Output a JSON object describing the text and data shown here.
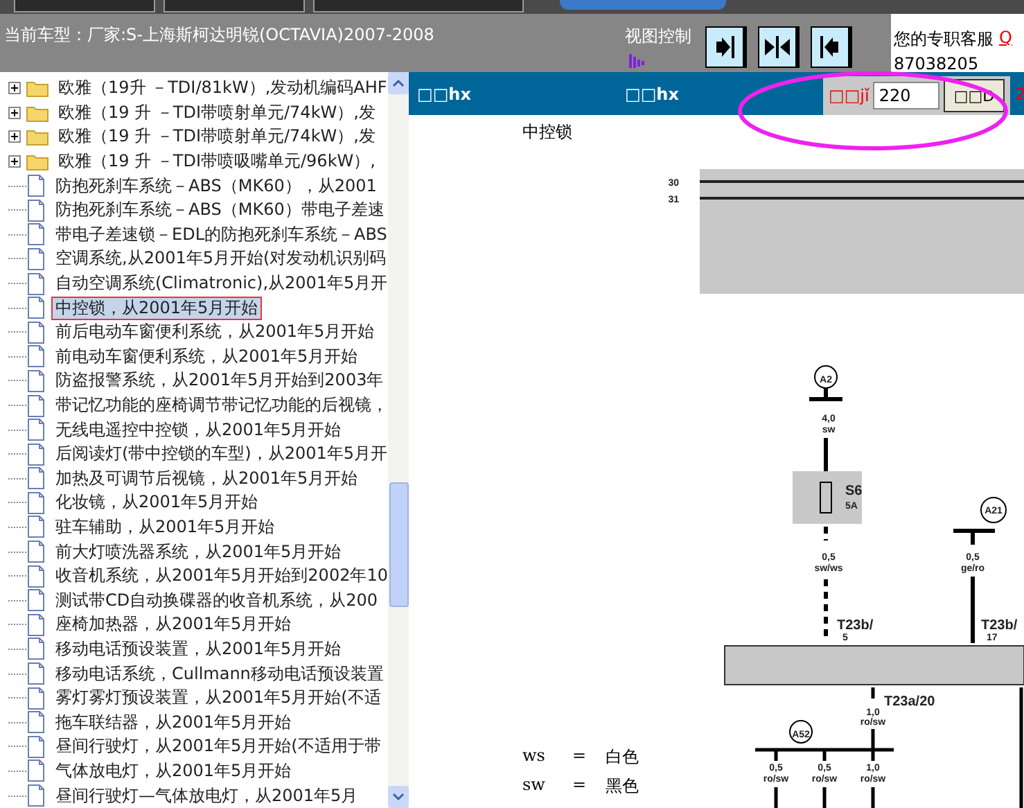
{
  "top_bar": {
    "tabs": [
      {
        "selected": false
      },
      {
        "selected": false
      },
      {
        "selected": false
      },
      {
        "selected": true
      }
    ],
    "model_label": "当前车型：厂家:S-上海斯柯达明锐(OCTAVIA)2007-2008",
    "view_control_label": "视图控制",
    "view_buttons": [
      {
        "kind": "right"
      },
      {
        "kind": "center"
      },
      {
        "kind": "left"
      }
    ],
    "service_label": "您的专职客服",
    "service_link": "Q",
    "service_number": "87038205"
  },
  "tree": {
    "items": [
      {
        "kind": "folder",
        "text": "欧雅（19升 －TDI/81kW）,发动机编码AHF",
        "selected": false
      },
      {
        "kind": "folder",
        "text": "欧雅（19 升 －TDI带喷射单元/74kW）,发",
        "selected": false
      },
      {
        "kind": "folder",
        "text": "欧雅（19 升 －TDI带喷射单元/74kW）,发",
        "selected": false
      },
      {
        "kind": "folder",
        "text": "欧雅（19 升 －TDI带喷吸嘴单元/96kW）,",
        "selected": false
      },
      {
        "kind": "doc",
        "text": "防抱死刹车系统－ABS（MK60），从2001",
        "selected": false
      },
      {
        "kind": "doc",
        "text": "防抱死刹车系统－ABS（MK60）带电子差速",
        "selected": false
      },
      {
        "kind": "doc",
        "text": "带电子差速锁－EDL的防抱死刹车系统－ABS",
        "selected": false
      },
      {
        "kind": "doc",
        "text": "空调系统,从2001年5月开始(对发动机识别码",
        "selected": false
      },
      {
        "kind": "doc",
        "text": "自动空调系统(Climatronic),从2001年5月开",
        "selected": false
      },
      {
        "kind": "doc",
        "text": "中控锁，从2001年5月开始",
        "selected": true
      },
      {
        "kind": "doc",
        "text": "前后电动车窗便利系统，从2001年5月开始",
        "selected": false
      },
      {
        "kind": "doc",
        "text": "前电动车窗便利系统，从2001年5月开始",
        "selected": false
      },
      {
        "kind": "doc",
        "text": "防盗报警系统，从2001年5月开始到2003年",
        "selected": false
      },
      {
        "kind": "doc",
        "text": "带记忆功能的座椅调节带记忆功能的后视镜，",
        "selected": false
      },
      {
        "kind": "doc",
        "text": "无线电遥控中控锁，从2001年5月开始",
        "selected": false
      },
      {
        "kind": "doc",
        "text": "后阅读灯(带中控锁的车型)，从2001年5月开",
        "selected": false
      },
      {
        "kind": "doc",
        "text": "加热及可调节后视镜，从2001年5月开始",
        "selected": false
      },
      {
        "kind": "doc",
        "text": "化妆镜，从2001年5月开始",
        "selected": false
      },
      {
        "kind": "doc",
        "text": "驻车辅助，从2001年5月开始",
        "selected": false
      },
      {
        "kind": "doc",
        "text": "前大灯喷洗器系统，从2001年5月开始",
        "selected": false
      },
      {
        "kind": "doc",
        "text": "收音机系统，从2001年5月开始到2002年10",
        "selected": false
      },
      {
        "kind": "doc",
        "text": "测试带CD自动换碟器的收音机系统，从200",
        "selected": false
      },
      {
        "kind": "doc",
        "text": "座椅加热器，从2001年5月开始",
        "selected": false
      },
      {
        "kind": "doc",
        "text": "移动电话预设装置，从2001年5月开始",
        "selected": false
      },
      {
        "kind": "doc",
        "text": "移动电话系统，Cullmann移动电话预设装置",
        "selected": false
      },
      {
        "kind": "doc",
        "text": "雾灯雾灯预设装置，从2001年5月开始(不适",
        "selected": false
      },
      {
        "kind": "doc",
        "text": "拖车联结器，从2001年5月开始",
        "selected": false
      },
      {
        "kind": "doc",
        "text": "昼间行驶灯，从2001年5月开始(不适用于带",
        "selected": false
      },
      {
        "kind": "doc",
        "text": "气体放电灯，从2001年5月开始",
        "selected": false
      },
      {
        "kind": "doc",
        "text": "昼间行驶灯—气体放电灯，从2001年5月",
        "selected": false
      }
    ]
  },
  "viewer": {
    "header_texts": [
      "□□hx",
      "□□hx"
    ],
    "page_label": "□□jǐ",
    "page_value": "220",
    "go_button": "□□D",
    "trailing_text": "2",
    "title": "中控锁",
    "diagram_labels": [
      "30",
      "31",
      "A2",
      "4,0",
      "sw",
      "S6",
      "5A",
      "0,5",
      "sw/ws",
      "T23b/",
      "5",
      "A21",
      "0,5",
      "ge/ro",
      "T23b/",
      "17",
      "T23a/20",
      "1,0",
      "ro/sw",
      "A52",
      "0,5",
      "ro/sw",
      "0,5",
      "ro/sw",
      "1,0",
      "ro/sw"
    ],
    "legend": [
      {
        "code": "ws",
        "eq": "=",
        "color_name": "白色"
      },
      {
        "code": "sw",
        "eq": "=",
        "color_name": "黑色"
      }
    ]
  }
}
